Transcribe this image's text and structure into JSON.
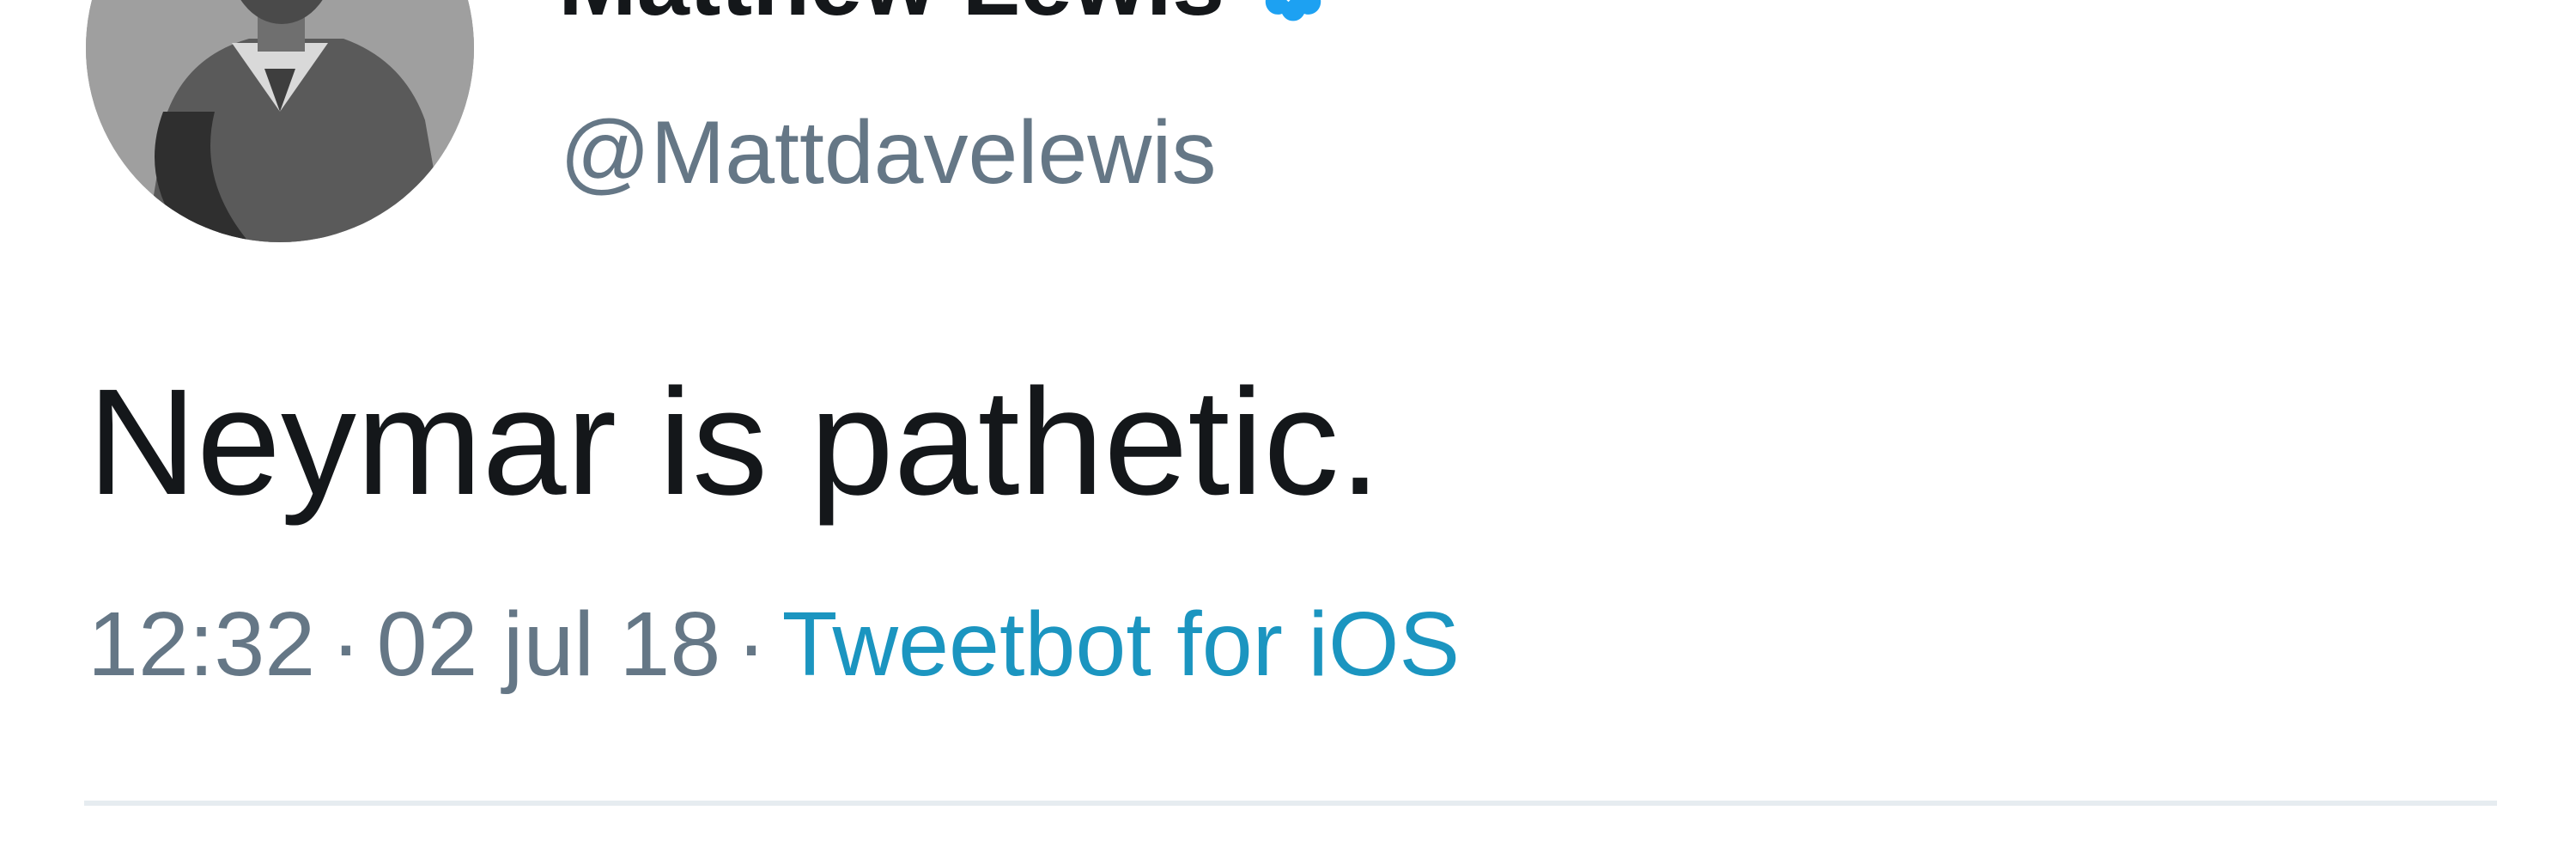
{
  "tweet": {
    "author": {
      "display_name": "Matthew Lewis",
      "handle": "@Mattdavelewis",
      "verified": true,
      "avatar_icon": "person-avatar-icon"
    },
    "text": "Neymar is pathetic.",
    "meta": {
      "time": "12:32",
      "separator": "·",
      "date": "02 jul 18",
      "source": "Tweetbot for iOS"
    }
  },
  "colors": {
    "text_primary": "#14171a",
    "text_secondary": "#657786",
    "link": "#1b95c0",
    "verified_badge": "#1da1f2",
    "divider": "#e6ecf0"
  }
}
